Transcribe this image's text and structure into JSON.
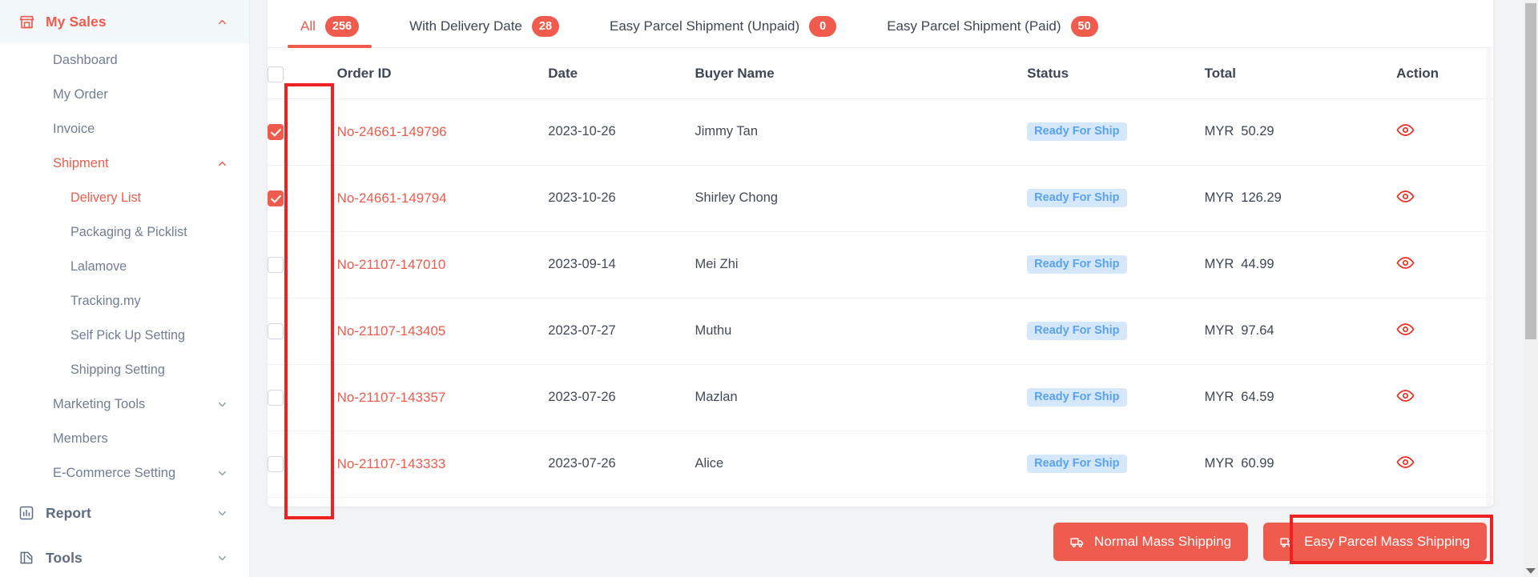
{
  "sidebar": {
    "groups": [
      {
        "label": "My Sales",
        "icon": "store-icon",
        "state": "expanded",
        "active": true
      },
      {
        "label": "Report",
        "icon": "bar-chart-icon",
        "state": "collapsed",
        "active": false
      },
      {
        "label": "Tools",
        "icon": "tools-icon",
        "state": "collapsed",
        "active": false
      }
    ],
    "my_sales_items": [
      {
        "label": "Dashboard",
        "level": 1,
        "active": false,
        "chevron": ""
      },
      {
        "label": "My Order",
        "level": 1,
        "active": false,
        "chevron": ""
      },
      {
        "label": "Invoice",
        "level": 1,
        "active": false,
        "chevron": ""
      },
      {
        "label": "Shipment",
        "level": 1,
        "active": true,
        "chevron": "up"
      },
      {
        "label": "Delivery List",
        "level": 2,
        "active": true,
        "chevron": ""
      },
      {
        "label": "Packaging & Picklist",
        "level": 2,
        "active": false,
        "chevron": ""
      },
      {
        "label": "Lalamove",
        "level": 2,
        "active": false,
        "chevron": ""
      },
      {
        "label": "Tracking.my",
        "level": 2,
        "active": false,
        "chevron": ""
      },
      {
        "label": "Self Pick Up Setting",
        "level": 2,
        "active": false,
        "chevron": ""
      },
      {
        "label": "Shipping Setting",
        "level": 2,
        "active": false,
        "chevron": ""
      },
      {
        "label": "Marketing Tools",
        "level": 1,
        "active": false,
        "chevron": "down"
      },
      {
        "label": "Members",
        "level": 1,
        "active": false,
        "chevron": ""
      },
      {
        "label": "E-Commerce Setting",
        "level": 1,
        "active": false,
        "chevron": "down"
      }
    ]
  },
  "tabs": [
    {
      "label": "All",
      "count": "256",
      "active": true
    },
    {
      "label": "With Delivery Date",
      "count": "28",
      "active": false
    },
    {
      "label": "Easy Parcel Shipment (Unpaid)",
      "count": "0",
      "active": false
    },
    {
      "label": "Easy Parcel Shipment (Paid)",
      "count": "50",
      "active": false
    }
  ],
  "table": {
    "select_all_checked": false,
    "columns": [
      "",
      "Order ID",
      "Date",
      "Buyer Name",
      "Status",
      "Total",
      "Action"
    ],
    "rows": [
      {
        "checked": true,
        "order_id": "No-24661-149796",
        "date": "2023-10-26",
        "buyer": "Jimmy Tan",
        "status": "Ready For Ship",
        "currency": "MYR",
        "amount": "50.29",
        "action": "view-icon"
      },
      {
        "checked": true,
        "order_id": "No-24661-149794",
        "date": "2023-10-26",
        "buyer": "Shirley Chong",
        "status": "Ready For Ship",
        "currency": "MYR",
        "amount": "126.29",
        "action": "view-icon"
      },
      {
        "checked": false,
        "order_id": "No-21107-147010",
        "date": "2023-09-14",
        "buyer": "Mei Zhi",
        "status": "Ready For Ship",
        "currency": "MYR",
        "amount": "44.99",
        "action": "view-icon"
      },
      {
        "checked": false,
        "order_id": "No-21107-143405",
        "date": "2023-07-27",
        "buyer": "Muthu",
        "status": "Ready For Ship",
        "currency": "MYR",
        "amount": "97.64",
        "action": "view-icon"
      },
      {
        "checked": false,
        "order_id": "No-21107-143357",
        "date": "2023-07-26",
        "buyer": "Mazlan",
        "status": "Ready For Ship",
        "currency": "MYR",
        "amount": "64.59",
        "action": "view-icon"
      },
      {
        "checked": false,
        "order_id": "No-21107-143333",
        "date": "2023-07-26",
        "buyer": "Alice",
        "status": "Ready For Ship",
        "currency": "MYR",
        "amount": "60.99",
        "action": "view-icon"
      }
    ]
  },
  "footer": {
    "normal_mass_shipping": "Normal Mass Shipping",
    "easy_parcel_mass_shipping": "Easy Parcel Mass Shipping"
  },
  "colors": {
    "accent": "#ef5b4c",
    "status_bg": "#d5e8fb",
    "status_fg": "#5aa2ef",
    "annotation": "#ee2222",
    "sidebar_text": "#707e94"
  }
}
